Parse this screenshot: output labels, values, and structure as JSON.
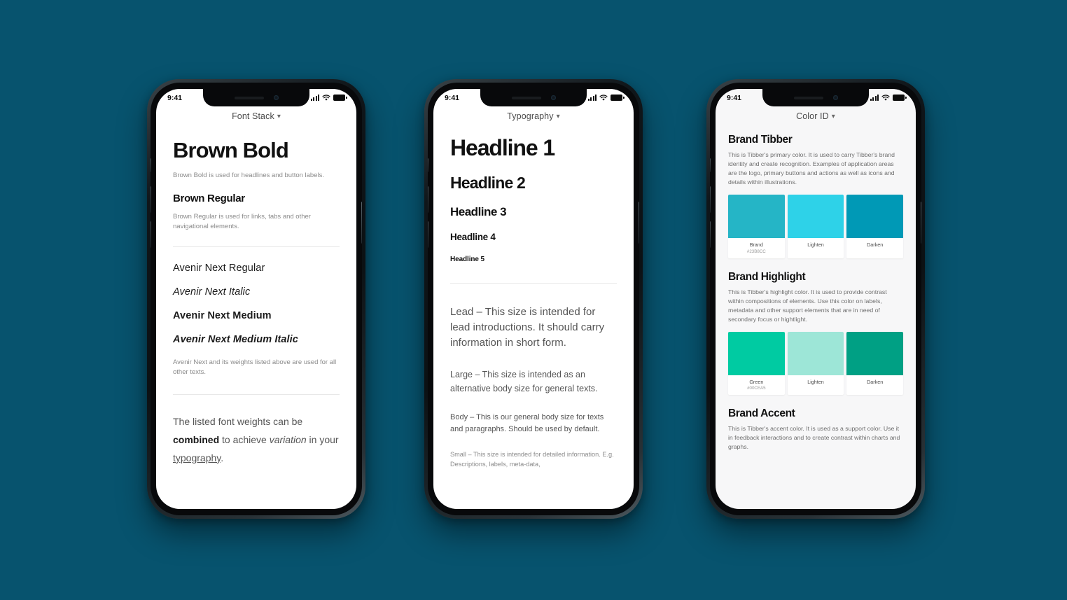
{
  "canvas": {
    "background": "#07536E"
  },
  "phones": [
    {
      "id": "font-stack",
      "status": {
        "time": "9:41"
      },
      "nav": {
        "title": "Font Stack",
        "chevron": "chevron-down-icon"
      },
      "headline": "Brown Bold",
      "headline_caption": "Brown Bold is used for headlines and button labels.",
      "subheadline": "Brown Regular",
      "subheadline_caption": "Brown Regular is used for links, tabs and other navigational elements.",
      "font_rows": [
        "Avenir Next Regular",
        "Avenir Next Italic",
        "Avenir Next Medium",
        "Avenir Next Medium Italic"
      ],
      "font_caption": "Avenir Next and its weights listed above are used for all other texts.",
      "footer": {
        "part1": "The listed font weights can be ",
        "bold": "combined",
        "part2": " to achieve ",
        "italic": "variation",
        "part3": " in your ",
        "link": "typography",
        "part4": "."
      }
    },
    {
      "id": "typography",
      "status": {
        "time": "9:41"
      },
      "nav": {
        "title": "Typography",
        "chevron": "chevron-down-icon"
      },
      "headlines": [
        "Headline 1",
        "Headline 2",
        "Headline 3",
        "Headline 4",
        "Headline 5"
      ],
      "lead": "Lead – This size is intended for lead introductions. It should carry information in short form.",
      "large": "Large – This size is intended as an alternative body size for general texts.",
      "body": "Body – This is our general body size for texts and paragraphs. Should be used by default.",
      "small": "Small – This size is intended for detailed information. E.g. Descriptions, labels, meta-data,"
    },
    {
      "id": "color-id",
      "status": {
        "time": "9:41"
      },
      "nav": {
        "title": "Color ID",
        "chevron": "chevron-down-icon"
      },
      "sections": [
        {
          "title": "Brand Tibber",
          "description": "This is Tibber's primary color. It is used to carry Tibber's brand identity and create recognition. Examples of application areas are the logo, primary buttons and actions as well as icons and details within illustrations.",
          "swatches": [
            {
              "name": "Brand",
              "hex": "#23B8CC",
              "color": "#25B5C6"
            },
            {
              "name": "Lighten",
              "hex": "",
              "color": "#2ED2E8"
            },
            {
              "name": "Darken",
              "hex": "",
              "color": "#0099B6"
            }
          ]
        },
        {
          "title": "Brand Highlight",
          "description": "This is Tibber's highlight color. It is used to provide contrast within compositions of elements. Use this color on labels, metadata and other support elements that are in need of secondary focus or hightlight.",
          "swatches": [
            {
              "name": "Green",
              "hex": "#00CEA5",
              "color": "#00CBA2"
            },
            {
              "name": "Lighten",
              "hex": "",
              "color": "#9DE6D7"
            },
            {
              "name": "Darken",
              "hex": "",
              "color": "#00A084"
            }
          ]
        },
        {
          "title": "Brand Accent",
          "description": "This is Tibber's accent color. It is used as a support color. Use it in feedback interactions and to create contrast within charts and graphs.",
          "swatches": []
        }
      ]
    }
  ]
}
